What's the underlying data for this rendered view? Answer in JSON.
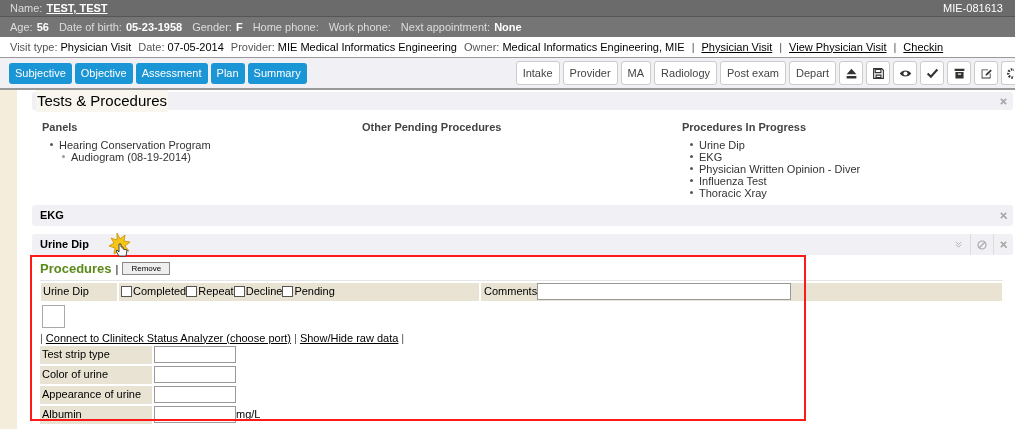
{
  "header": {
    "name_label": "Name:",
    "name_value": "TEST, TEST",
    "record_id": "MIE-081613",
    "demographics": [
      {
        "label": "Age:",
        "value": "56"
      },
      {
        "label": "Date of birth:",
        "value": "05-23-1958"
      },
      {
        "label": "Gender:",
        "value": "F"
      },
      {
        "label": "Home phone:"
      },
      {
        "label": "Work phone:"
      },
      {
        "label": "Next appointment:",
        "value": "None"
      }
    ],
    "visit_info": [
      {
        "kind": "field",
        "label": "Visit type:",
        "value": "Physician Visit"
      },
      {
        "kind": "field",
        "label": "Date:",
        "value": "07-05-2014"
      },
      {
        "kind": "field",
        "label": "Provider:",
        "value": "MIE Medical Informatics Engineering"
      },
      {
        "kind": "field",
        "label": "Owner:",
        "value": "Medical Informatics Engineering, MIE"
      },
      {
        "kind": "separator",
        "text": "|"
      },
      {
        "kind": "link",
        "text": "Physician Visit"
      },
      {
        "kind": "separator",
        "text": "|"
      },
      {
        "kind": "link",
        "text": "View Physician Visit"
      },
      {
        "kind": "separator",
        "text": "|"
      },
      {
        "kind": "link",
        "text": "Checkin"
      }
    ]
  },
  "nav_tabs": [
    "Subjective",
    "Objective",
    "Assessment",
    "Plan",
    "Summary"
  ],
  "toolbar_buttons": [
    "Intake",
    "Provider",
    "MA",
    "Radiology",
    "Post exam",
    "Depart"
  ],
  "tests_panel": {
    "title": "Tests & Procedures",
    "columns": [
      {
        "heading": "Panels",
        "items": [
          {
            "text": "Hearing Conservation Program",
            "children": [
              {
                "text": "Audiogram (08-19-2014)"
              }
            ]
          }
        ]
      },
      {
        "heading": "Other Pending Procedures"
      },
      {
        "heading": "Procedures In Progress",
        "items": [
          {
            "text": "Urine Dip"
          },
          {
            "text": "EKG"
          },
          {
            "text": "Physician Written Opinion - Diver"
          },
          {
            "text": "Influenza Test"
          },
          {
            "text": "Thoracic Xray"
          }
        ]
      }
    ]
  },
  "sections": [
    {
      "title": "EKG",
      "expanded": false
    },
    {
      "title": "Urine Dip",
      "expanded": true
    }
  ],
  "procedures": {
    "title": "Procedures",
    "separator": "|",
    "remove_button": "Remove",
    "name": "Urine Dip",
    "options": [
      {
        "label": "Completed",
        "checked": false
      },
      {
        "label": "Repeat",
        "checked": false
      },
      {
        "label": "Decline",
        "checked": false
      },
      {
        "label": "Pending",
        "checked": false
      }
    ],
    "comments_label": "Comments",
    "links": [
      {
        "kind": "separator",
        "text": "|"
      },
      {
        "kind": "link",
        "text": "Connect to Cliniteck Status Analyzer (choose port)"
      },
      {
        "kind": "separator",
        "text": "|"
      },
      {
        "kind": "link",
        "text": "Show/Hide raw data"
      },
      {
        "kind": "separator",
        "text": "|"
      }
    ],
    "fields": [
      {
        "label": "Test strip type"
      },
      {
        "label": "Color of urine"
      },
      {
        "label": "Appearance of urine"
      },
      {
        "label": "Albumin",
        "unit": "mg/L"
      }
    ]
  }
}
